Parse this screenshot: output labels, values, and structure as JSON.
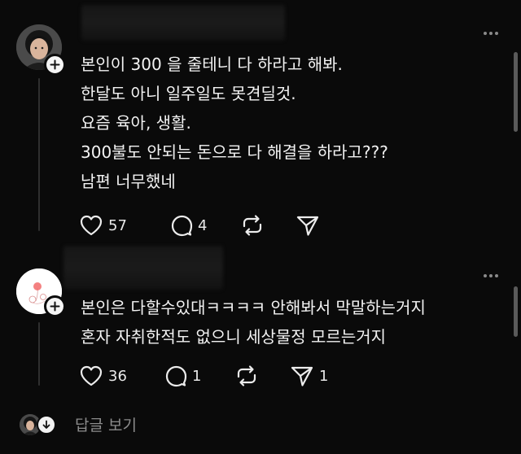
{
  "posts": [
    {
      "lines": [
        "본인이 300 을 줄테니 다 하라고 해봐.",
        "한달도  아니 일주일도 못견딜것.",
        "요즘 육아, 생활.",
        "300불도 안되는 돈으로 다 해결을 하라고???",
        "남편 너무했네"
      ],
      "likes": "57",
      "comments": "4",
      "reposts": "",
      "shares": ""
    },
    {
      "lines": [
        "본인은 다할수있대ㅋㅋㅋㅋ 안해봐서 막말하는거지",
        "혼자 자취한적도 없으니 세상물정 모르는거지"
      ],
      "likes": "36",
      "comments": "1",
      "reposts": "",
      "shares": "1"
    }
  ],
  "footer": {
    "view_replies_label": "답글 보기"
  },
  "icons": {
    "like": "heart-icon",
    "comment": "speech-bubble-icon",
    "repost": "repost-icon",
    "share": "paper-plane-icon",
    "follow": "plus-icon",
    "more": "more-dots-icon",
    "expand": "arrow-down-icon"
  },
  "colors": {
    "background": "#0a0a0a",
    "text": "#f3f3f3",
    "muted": "#8c8c8c",
    "thread_line": "#2f2f2f"
  }
}
